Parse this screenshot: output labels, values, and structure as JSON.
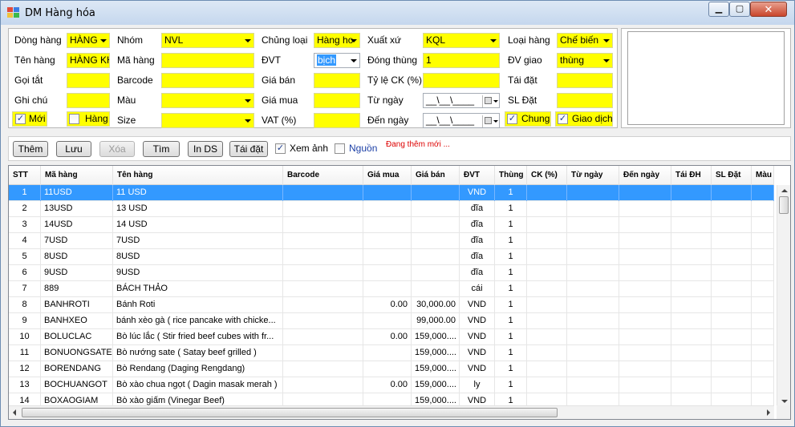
{
  "window": {
    "title": "DM Hàng hóa",
    "minimize_icon": "minimize-icon",
    "maximize_icon": "maximize-icon",
    "close_icon": "close-icon"
  },
  "form": {
    "dong_hang": {
      "label": "Dòng hàng",
      "value": "HÀNG"
    },
    "nhom": {
      "label": "Nhóm",
      "value": "NVL"
    },
    "chung_loai": {
      "label": "Chủng loại",
      "value": "Hàng ho"
    },
    "xuat_xu": {
      "label": "Xuất xứ",
      "value": "KQL"
    },
    "loai_hang": {
      "label": "Loại hàng",
      "value": "Chế biến"
    },
    "ten_hang": {
      "label": "Tên hàng",
      "value": "HÀNG KH"
    },
    "ma_hang": {
      "label": "Mã hàng",
      "value": ""
    },
    "dvt": {
      "label": "ĐVT",
      "value": "bịch"
    },
    "dong_thung": {
      "label": "Đóng thùng",
      "value": "1"
    },
    "dv_giao": {
      "label": "ĐV giao",
      "value": "thùng"
    },
    "goi_tat": {
      "label": "Gọi tắt",
      "value": ""
    },
    "barcode": {
      "label": "Barcode",
      "value": ""
    },
    "gia_ban": {
      "label": "Giá bán",
      "value": ""
    },
    "ty_le_ck": {
      "label": "Tỷ lệ CK (%)",
      "value": ""
    },
    "tai_dat": {
      "label": "Tái đặt",
      "value": ""
    },
    "ghi_chu": {
      "label": "Ghi chú",
      "value": ""
    },
    "mau": {
      "label": "Màu",
      "value": ""
    },
    "gia_mua": {
      "label": "Giá mua",
      "value": ""
    },
    "tu_ngay": {
      "label": "Từ ngày",
      "value": "__\\__\\____"
    },
    "sl_dat": {
      "label": "SL Đặt",
      "value": ""
    },
    "moi": {
      "label": "Mới",
      "checked": true
    },
    "hang": {
      "label": "Hàng",
      "checked": false
    },
    "size": {
      "label": "Size",
      "value": ""
    },
    "vat": {
      "label": "VAT (%)",
      "value": ""
    },
    "den_ngay": {
      "label": "Đến ngày",
      "value": "__\\__\\____"
    },
    "chung": {
      "label": "Chung",
      "checked": true
    },
    "giao_dich": {
      "label": "Giao dịch",
      "checked": true
    },
    "check_mark": "✓"
  },
  "toolbar": {
    "them": "Thêm",
    "luu": "Lưu",
    "xoa": "Xóa",
    "tim": "Tìm",
    "in_ds": "In DS",
    "tai_dat": "Tái đặt",
    "xem_anh": {
      "label": "Xem ảnh",
      "checked": true
    },
    "nguon": {
      "label": "Nguồn",
      "checked": false
    },
    "status": "Đang thêm mới ..."
  },
  "grid": {
    "columns": [
      "STT",
      "Mã hàng",
      "Tên hàng",
      "Barcode",
      "Giá mua",
      "Giá bán",
      "ĐVT",
      "Thùng",
      "CK (%)",
      "Từ ngày",
      "Đến ngày",
      "Tái ĐH",
      "SL Đặt",
      "Màu"
    ],
    "rows": [
      [
        "1",
        "11USD",
        "11 USD",
        "",
        "",
        "",
        "VND",
        "1"
      ],
      [
        "2",
        "13USD",
        "13 USD",
        "",
        "",
        "",
        "đĩa",
        "1"
      ],
      [
        "3",
        "14USD",
        "14 USD",
        "",
        "",
        "",
        "đĩa",
        "1"
      ],
      [
        "4",
        "7USD",
        "7USD",
        "",
        "",
        "",
        "đĩa",
        "1"
      ],
      [
        "5",
        "8USD",
        "8USD",
        "",
        "",
        "",
        "đĩa",
        "1"
      ],
      [
        "6",
        "9USD",
        "9USD",
        "",
        "",
        "",
        "đĩa",
        "1"
      ],
      [
        "7",
        "889",
        "BÁCH THẢO",
        "",
        "",
        "",
        "cái",
        "1"
      ],
      [
        "8",
        "BANHROTI",
        "Bánh Roti",
        "",
        "0.00",
        "30,000.00",
        "VND",
        "1"
      ],
      [
        "9",
        "BANHXEO",
        "bánh xèo gà ( rice pancake with chicke...",
        "",
        "",
        "99,000.00",
        "VND",
        "1"
      ],
      [
        "10",
        "BOLUCLAC",
        "Bò lúc lắc ( Stir fried beef cubes with fr...",
        "",
        "0.00",
        "159,000....",
        "VND",
        "1"
      ],
      [
        "11",
        "BONUONGSATE",
        "Bò nướng sate ( Satay beef grilled )",
        "",
        "",
        "159,000....",
        "VND",
        "1"
      ],
      [
        "12",
        "BORENDANG",
        "Bò Rendang (Daging Rengdang)",
        "",
        "",
        "159,000....",
        "VND",
        "1"
      ],
      [
        "13",
        "BOCHUANGOT",
        "Bò xào chua ngọt ( Dagin masak merah )",
        "",
        "0.00",
        "159,000....",
        "ly",
        "1"
      ],
      [
        "14",
        "BOXAOGIAM",
        "Bò xào giấm (Vinegar Beef)",
        "",
        "",
        "159,000....",
        "VND",
        "1"
      ]
    ],
    "selected_row": 0
  },
  "colors": {
    "highlight_field": "#ffff00",
    "selection": "#3399ff",
    "status_text": "#dd0000"
  }
}
